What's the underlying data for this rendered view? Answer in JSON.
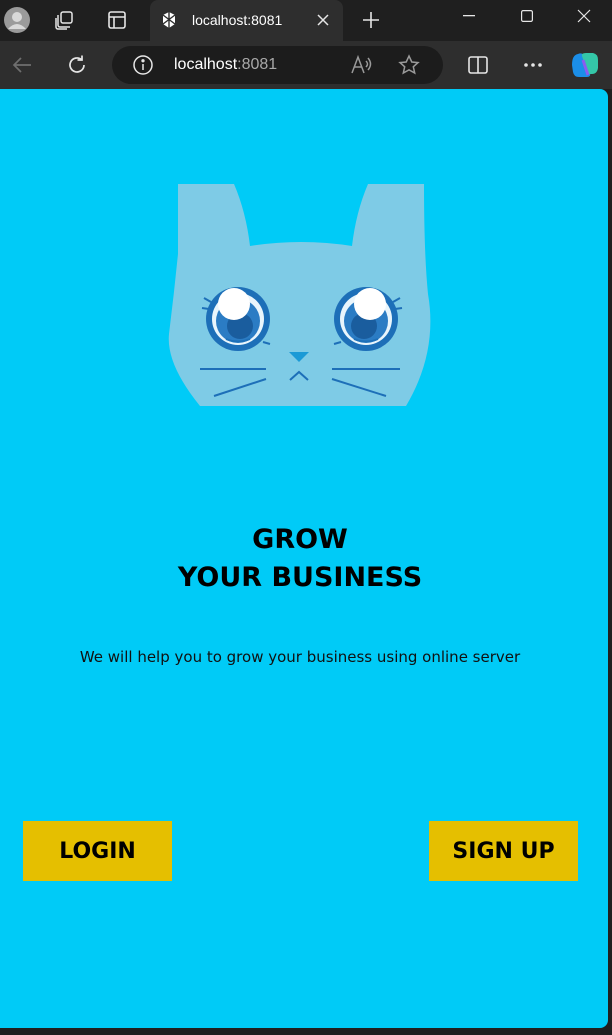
{
  "browser": {
    "tab": {
      "title": "localhost:8081"
    },
    "address": {
      "host": "localhost",
      "port": ":8081"
    }
  },
  "page": {
    "headline_line1": "GROW",
    "headline_line2": "YOUR BUSINESS",
    "subtext": "We will help you to grow your business using online server",
    "login_label": "LOGIN",
    "signup_label": "SIGN UP"
  },
  "colors": {
    "page_background": "#00cbf7",
    "button_background": "#e5bf00",
    "cat_body": "#7ecbe6",
    "cat_eye": "#1d6fb8"
  },
  "icons": [
    "profile-icon",
    "workspaces-icon",
    "tab-actions-icon",
    "favicon-icon",
    "close-tab-icon",
    "new-tab-icon",
    "minimize-icon",
    "maximize-icon",
    "close-window-icon",
    "back-icon",
    "refresh-icon",
    "site-info-icon",
    "read-aloud-icon",
    "favorite-star-icon",
    "split-screen-icon",
    "more-icon",
    "copilot-icon"
  ]
}
